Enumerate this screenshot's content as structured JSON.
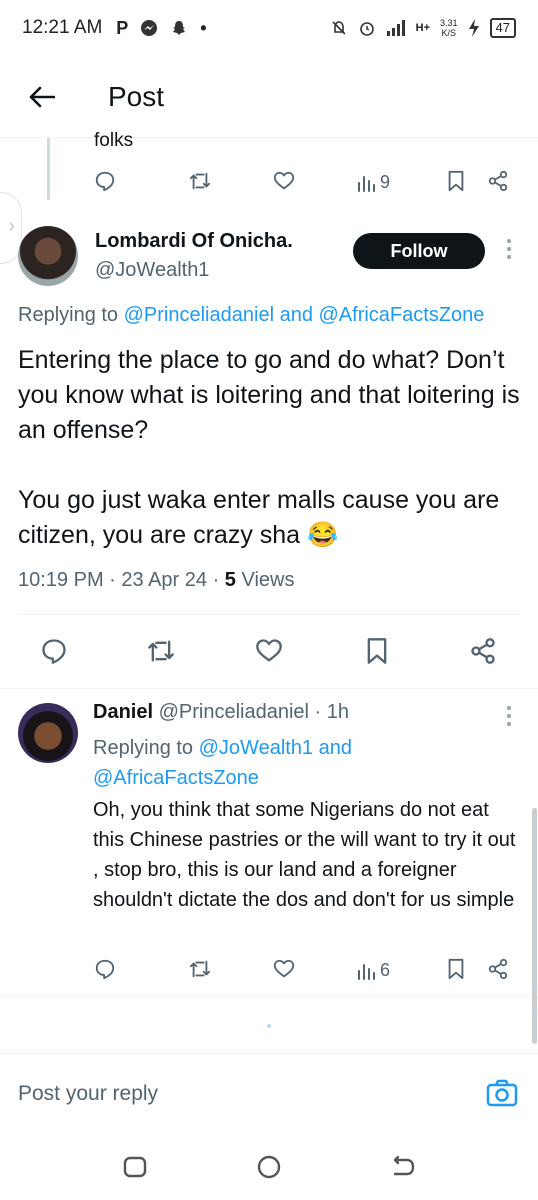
{
  "status_bar": {
    "time": "12:21 AM",
    "app_icons": [
      "P",
      "messenger-icon",
      "snapchat-icon",
      "•"
    ],
    "net_speed_value": "3.31",
    "net_speed_unit": "K/S",
    "network_label": "H+",
    "battery": "47"
  },
  "header": {
    "title": "Post"
  },
  "previous_post": {
    "text_tail": "folks",
    "views": "9"
  },
  "main_post": {
    "name": "Lombardi Of Onicha.",
    "handle": "@JoWealth1",
    "follow_label": "Follow",
    "replying_prefix": "Replying to ",
    "replying_user1": "@Princeliadaniel",
    "replying_and": " and ",
    "replying_user2": "@AfricaFactsZone",
    "paragraph1": "Entering the place to go and do what? Don’t you know what is loitering and that loitering is an offense?",
    "paragraph2": "You go just waka enter malls cause you are citizen, you are crazy sha 😂",
    "time": "10:19 PM",
    "sep": " · ",
    "date": "23 Apr 24",
    "views_count": "5",
    "views_label": " Views"
  },
  "reply": {
    "name": "Daniel",
    "handle": "@Princeliadaniel",
    "age": "· 1h",
    "replying_prefix": "Replying to ",
    "replying_user1": "@JoWealth1",
    "replying_and": " and",
    "replying_user2": "@AfricaFactsZone",
    "text": "Oh, you think that some Nigerians do not eat this Chinese pastries or the will want to try it out , stop bro, this is our land and a foreigner shouldn't dictate the dos and don't for us simple",
    "views": "6"
  },
  "composer": {
    "placeholder": "Post your reply"
  },
  "colors": {
    "accent": "#1d9bf0",
    "text": "#0f1419",
    "muted": "#536471",
    "follow_bg": "#0f1419"
  }
}
